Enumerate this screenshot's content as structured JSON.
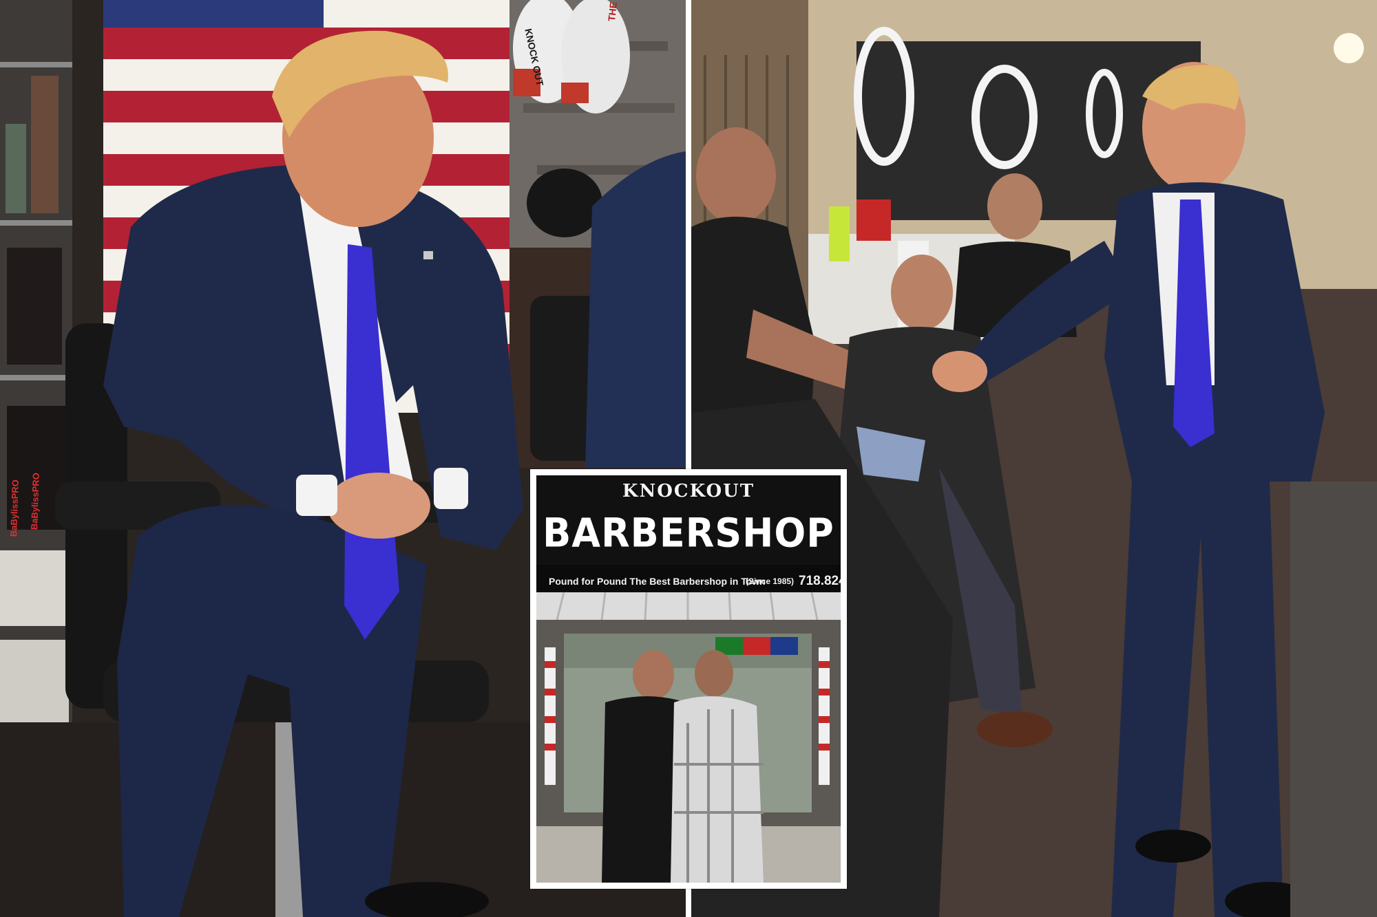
{
  "image": {
    "layout": "two side-by-side photos with a smaller inset photo centered at the bottom"
  },
  "left_photo": {
    "glove_text_1": "KNOCK OUT",
    "glove_text_2": "THE CLOT",
    "product_label_1": "BaBylissPRO",
    "product_label_2": "BaBylissPRO"
  },
  "inset_photo": {
    "sign_logo": "KNOCKOUT",
    "sign_main": "BARBERSHOP",
    "sign_tagline": "Pound for Pound The Best Barbershop in Town",
    "sign_since": "(Since 1985)",
    "sign_phone": "718.824"
  },
  "colors": {
    "suit_navy": "#1f2a4a",
    "tie_blue": "#3a2fd0",
    "flag_red": "#b22234",
    "sign_black": "#111111",
    "inset_border": "#ffffff"
  }
}
